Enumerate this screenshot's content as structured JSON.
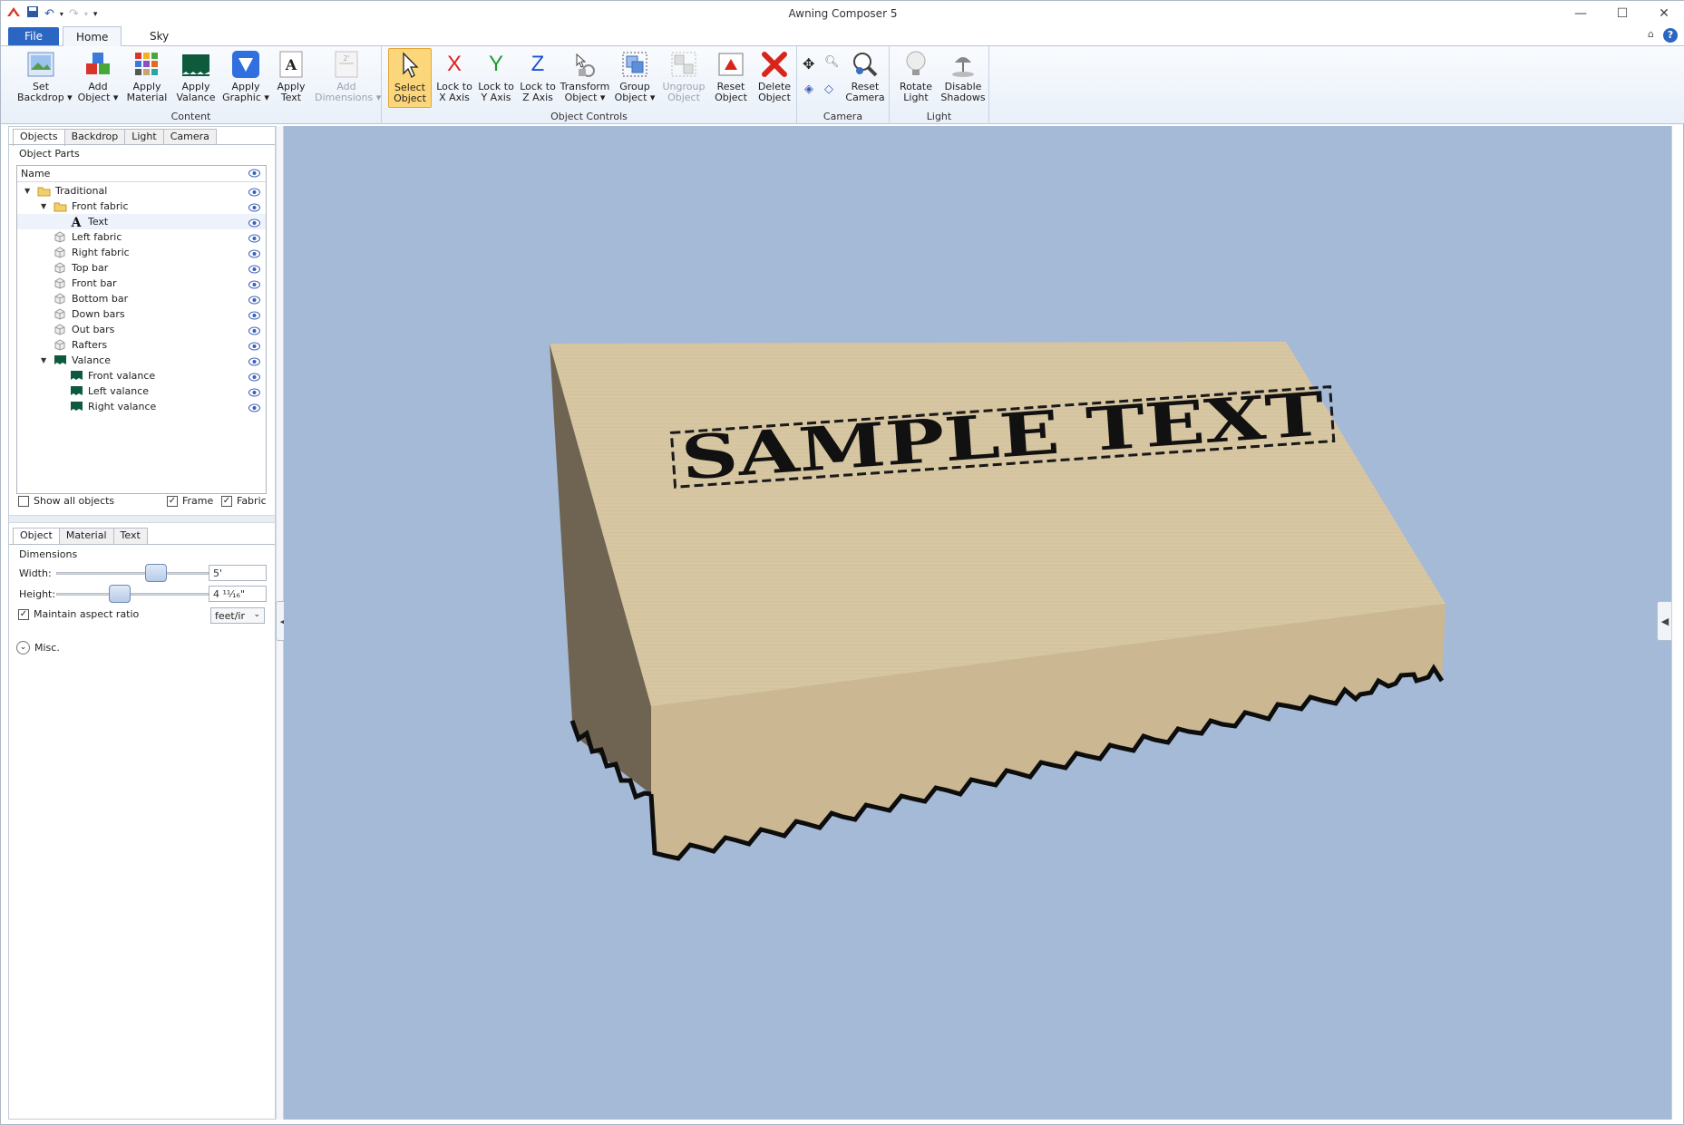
{
  "window": {
    "title": "Awning Composer 5",
    "controls": [
      "minimize",
      "maximize",
      "close"
    ]
  },
  "quick_access": [
    "app-icon",
    "save-icon",
    "undo-icon",
    "redo-icon",
    "customize-icon"
  ],
  "ribbon_tabs": [
    {
      "label": "File"
    },
    {
      "label": "Home"
    },
    {
      "label": "Sky"
    }
  ],
  "ribbon": {
    "groups": [
      {
        "label": "Content",
        "buttons": [
          {
            "label": "Set\nBackdrop ▾",
            "icon": "backdrop-icon"
          },
          {
            "label": "Add\nObject ▾",
            "icon": "add-object-icon"
          },
          {
            "label": "Apply\nMaterial",
            "icon": "material-icon"
          },
          {
            "label": "Apply\nValance",
            "icon": "valance-icon"
          },
          {
            "label": "Apply\nGraphic ▾",
            "icon": "graphic-icon"
          },
          {
            "label": "Apply\nText",
            "icon": "text-icon"
          },
          {
            "label": "Add\nDimensions ▾",
            "icon": "dimensions-icon",
            "disabled": true
          }
        ]
      },
      {
        "label": "Object Controls",
        "buttons": [
          {
            "label": "Select\nObject",
            "icon": "select-cursor-icon",
            "selected": true
          },
          {
            "label": "Lock to\nX Axis",
            "icon": "x-axis-icon",
            "glyph": "X",
            "color": "#e0221c"
          },
          {
            "label": "Lock to\nY Axis",
            "icon": "y-axis-icon",
            "glyph": "Y",
            "color": "#1f9a2e"
          },
          {
            "label": "Lock to\nZ Axis",
            "icon": "z-axis-icon",
            "glyph": "Z",
            "color": "#1c4fd8"
          },
          {
            "label": "Transform\nObject ▾",
            "icon": "transform-icon"
          },
          {
            "label": "Group\nObject ▾",
            "icon": "group-icon"
          },
          {
            "label": "Ungroup\nObject",
            "icon": "ungroup-icon",
            "disabled": true
          },
          {
            "label": "Reset\nObject",
            "icon": "reset-object-icon"
          },
          {
            "label": "Delete\nObject",
            "icon": "delete-icon"
          }
        ]
      },
      {
        "label": "Camera",
        "buttons": [
          {
            "label": "Reset\nCamera",
            "icon": "reset-camera-icon"
          }
        ]
      },
      {
        "label": "Light",
        "buttons": [
          {
            "label": "Rotate\nLight",
            "icon": "bulb-icon"
          },
          {
            "label": "Disable\nShadows",
            "icon": "shadow-lamp-icon"
          }
        ]
      }
    ]
  },
  "left_panel": {
    "top_tabs": [
      "Objects",
      "Backdrop",
      "Light",
      "Camera"
    ],
    "object_parts_label": "Object Parts",
    "tree_header": "Name",
    "tree": [
      {
        "label": "Traditional",
        "level": 0,
        "icon": "folder-icon",
        "expanded": true
      },
      {
        "label": "Front fabric",
        "level": 1,
        "icon": "folder-icon",
        "expanded": true
      },
      {
        "label": "Text",
        "level": 2,
        "icon": "text-glyph-icon",
        "selected": true
      },
      {
        "label": "Left fabric",
        "level": 1,
        "icon": "part-icon"
      },
      {
        "label": "Right fabric",
        "level": 1,
        "icon": "part-icon"
      },
      {
        "label": "Top bar",
        "level": 1,
        "icon": "part-icon"
      },
      {
        "label": "Front bar",
        "level": 1,
        "icon": "part-icon"
      },
      {
        "label": "Bottom bar",
        "level": 1,
        "icon": "part-icon"
      },
      {
        "label": "Down bars",
        "level": 1,
        "icon": "part-icon"
      },
      {
        "label": "Out bars",
        "level": 1,
        "icon": "part-icon"
      },
      {
        "label": "Rafters",
        "level": 1,
        "icon": "part-icon"
      },
      {
        "label": "Valance",
        "level": 1,
        "icon": "valance-part-icon",
        "expanded": true
      },
      {
        "label": "Front valance",
        "level": 2,
        "icon": "valance-part-icon"
      },
      {
        "label": "Left valance",
        "level": 2,
        "icon": "valance-part-icon"
      },
      {
        "label": "Right valance",
        "level": 2,
        "icon": "valance-part-icon"
      }
    ],
    "show_all_objects": {
      "label": "Show all objects",
      "checked": false
    },
    "frame": {
      "label": "Frame",
      "checked": true
    },
    "fabric": {
      "label": "Fabric",
      "checked": true
    },
    "bottom_tabs": [
      "Object",
      "Material",
      "Text"
    ],
    "dimensions_label": "Dimensions",
    "width": {
      "label": "Width:",
      "value": "5'",
      "slider": 0.68
    },
    "height": {
      "label": "Height:",
      "value": "4 ¹¹⁄₁₆\"",
      "slider": 0.4
    },
    "maintain_aspect": {
      "label": "Maintain aspect ratio",
      "checked": true
    },
    "units": "feet/ir",
    "misc_label": "Misc."
  },
  "viewport": {
    "background": "#a5bad7",
    "awning_text": "SAMPLE TEXT",
    "fabric_color": "#d8c7a3"
  }
}
